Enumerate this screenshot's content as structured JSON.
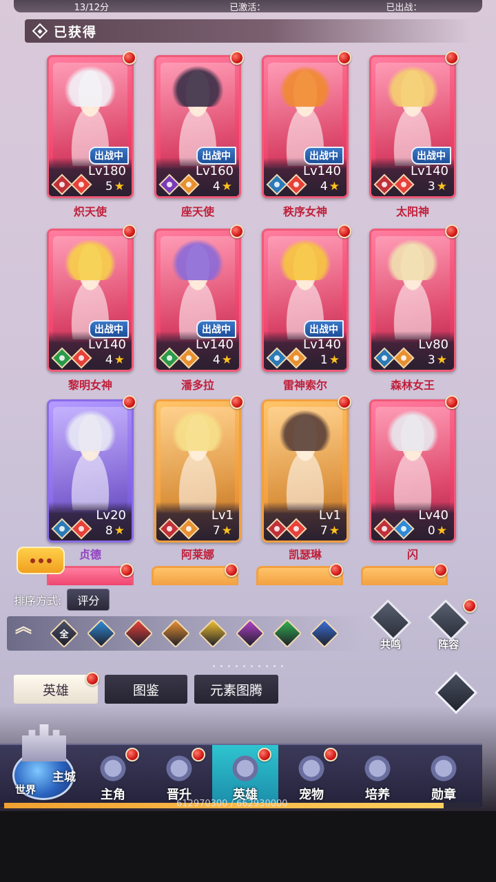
{
  "header": {
    "section_title": "已获得"
  },
  "top_partial": {
    "a": "13/12分",
    "b": "已激活：",
    "c": "已出战："
  },
  "heroes": [
    {
      "name": "炽天使",
      "level": "Lv180",
      "stars": "5",
      "in_battle": true,
      "frame": "pink",
      "elements": [
        "warrior-icon",
        "fire-icon"
      ],
      "hair": "#f2f2f8"
    },
    {
      "name": "座天使",
      "level": "Lv160",
      "stars": "4",
      "in_battle": true,
      "frame": "pink",
      "elements": [
        "mage-icon",
        "earth-icon"
      ],
      "hair": "#3a2f48"
    },
    {
      "name": "秩序女神",
      "level": "Lv140",
      "stars": "4",
      "in_battle": true,
      "frame": "pink",
      "elements": [
        "guardian-icon",
        "fire-icon"
      ],
      "hair": "#f08a30"
    },
    {
      "name": "太阳神",
      "level": "Lv140",
      "stars": "3",
      "in_battle": true,
      "frame": "pink",
      "elements": [
        "warrior-icon",
        "fire-icon"
      ],
      "hair": "#f4d070"
    },
    {
      "name": "黎明女神",
      "level": "Lv140",
      "stars": "4",
      "in_battle": true,
      "frame": "pink",
      "elements": [
        "healer-icon",
        "fire-icon"
      ],
      "hair": "#f6d04a"
    },
    {
      "name": "潘多拉",
      "level": "Lv140",
      "stars": "4",
      "in_battle": true,
      "frame": "pink",
      "elements": [
        "healer-icon",
        "earth-icon"
      ],
      "hair": "#8a6ad8"
    },
    {
      "name": "雷神索尔",
      "level": "Lv140",
      "stars": "1",
      "in_battle": true,
      "frame": "pink",
      "elements": [
        "guardian-icon",
        "earth-icon"
      ],
      "hair": "#f6c640"
    },
    {
      "name": "森林女王",
      "level": "Lv80",
      "stars": "3",
      "in_battle": false,
      "frame": "pink",
      "elements": [
        "guardian-icon",
        "earth-icon"
      ],
      "hair": "#f0e0b0"
    },
    {
      "name": "贞德",
      "level": "Lv20",
      "stars": "8",
      "in_battle": false,
      "frame": "purple",
      "elements": [
        "guardian-icon",
        "fire-icon"
      ],
      "hair": "#e8e8f4"
    },
    {
      "name": "阿莱娜",
      "level": "Lv1",
      "stars": "7",
      "in_battle": false,
      "frame": "orange",
      "elements": [
        "warrior-icon",
        "earth-icon"
      ],
      "hair": "#f6e08a"
    },
    {
      "name": "凯瑟琳",
      "level": "Lv1",
      "stars": "7",
      "in_battle": false,
      "frame": "orange",
      "elements": [
        "warrior-icon",
        "fire-icon"
      ],
      "hair": "#5a4038"
    },
    {
      "name": "闪",
      "level": "Lv40",
      "stars": "0",
      "in_battle": false,
      "frame": "pink",
      "elements": [
        "warrior-icon",
        "water-icon"
      ],
      "hair": "#e8e8ee"
    }
  ],
  "in_battle_label": "出战中",
  "partial_row": [
    "pink",
    "orange",
    "orange",
    "orange"
  ],
  "sort": {
    "label": "排序方式:",
    "value": "评分"
  },
  "filters": [
    {
      "name": "all",
      "label": "全",
      "color": "#4a4f68"
    },
    {
      "name": "water",
      "label": "",
      "color": "#2f8ad8"
    },
    {
      "name": "fire",
      "label": "",
      "color": "#e8403a"
    },
    {
      "name": "earth",
      "label": "",
      "color": "#e89030"
    },
    {
      "name": "light",
      "label": "",
      "color": "#f0c030"
    },
    {
      "name": "dark",
      "label": "",
      "color": "#b040c8"
    },
    {
      "name": "wind",
      "label": "",
      "color": "#30b050"
    },
    {
      "name": "star",
      "label": "",
      "color": "#3a70d8"
    }
  ],
  "side_buttons": [
    {
      "label": "共鸣"
    },
    {
      "label": "阵容"
    }
  ],
  "tabs": [
    {
      "label": "英雄",
      "active": true
    },
    {
      "label": "图鉴",
      "active": false
    },
    {
      "label": "元素图腾",
      "active": false
    }
  ],
  "nav": {
    "world_label": "世界",
    "main_city_label": "主城",
    "items": [
      {
        "label": "主角",
        "dot": true
      },
      {
        "label": "晋升",
        "dot": true
      },
      {
        "label": "英雄",
        "dot": true,
        "active": true
      },
      {
        "label": "宠物",
        "dot": true
      },
      {
        "label": "培养",
        "dot": false
      },
      {
        "label": "勋章",
        "dot": false
      }
    ]
  },
  "exp": {
    "text": "612970300 / 662930000",
    "progress": 0.925
  },
  "colors": {
    "pink": "#f05a78",
    "purple": "#8a6be8",
    "orange": "#f2a040",
    "accent_blue": "#2fc4d0"
  }
}
